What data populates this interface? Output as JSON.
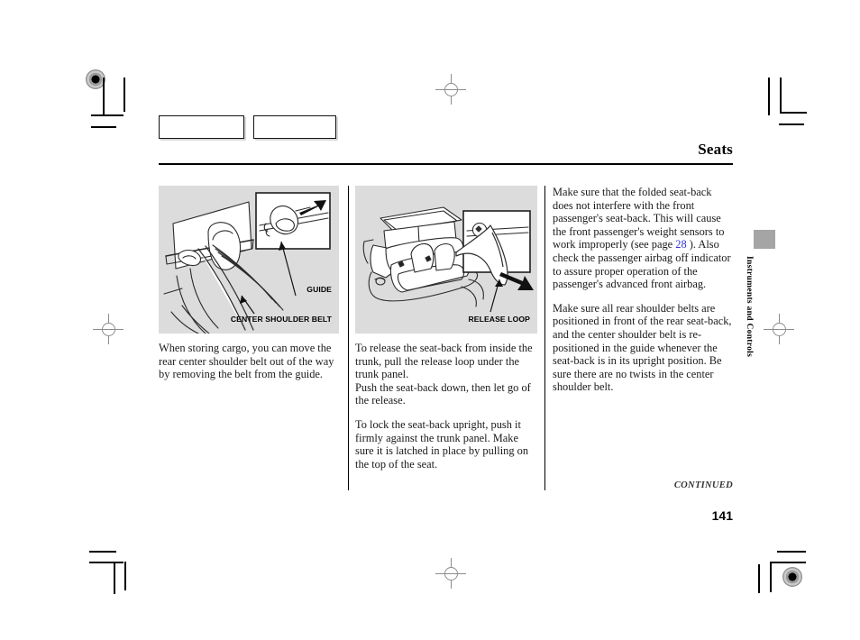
{
  "document": {
    "page_title": "Seats",
    "page_number": "141",
    "continued_label": "CONTINUED",
    "side_tab_label": "Instruments and Controls"
  },
  "figures": [
    {
      "name": "center-shoulder-belt-guide",
      "callouts": [
        {
          "text": "GUIDE"
        },
        {
          "text": "CENTER SHOULDER BELT"
        }
      ]
    },
    {
      "name": "trunk-release-loop",
      "callouts": [
        {
          "text": "RELEASE LOOP"
        }
      ]
    }
  ],
  "columns": {
    "left": {
      "paragraphs": [
        "When storing cargo, you can move the rear center shoulder belt out of the way by removing the belt from the guide."
      ]
    },
    "middle": {
      "paragraphs": [
        "To release the seat-back from inside the trunk, pull the release loop under the trunk panel.",
        "Push the seat-back down, then let go of the release.",
        "To lock the seat-back upright, push it firmly against the trunk panel. Make sure it is latched in place by pulling on the top of the seat."
      ]
    },
    "right": {
      "paragraph_1_before_link": "Make sure that the folded seat-back does not interfere with the front passenger's seat-back. This will cause the front passenger's weight sensors to work improperly (see page ",
      "paragraph_1_link": "28",
      "paragraph_1_after_link": " ). Also check the passenger airbag off indicator to assure proper operation of the passenger's advanced front airbag.",
      "paragraph_2": "Make sure all rear shoulder belts are positioned in front of the rear seat-back, and the center shoulder belt is re-positioned in the guide whenever the seat-back is in its upright position. Be sure there are no twists in the center shoulder belt."
    }
  },
  "colors": {
    "figure_background": "#dcdcdc",
    "link": "#3333dd",
    "side_tab": "#a5a5a5",
    "rule": "#000000"
  }
}
